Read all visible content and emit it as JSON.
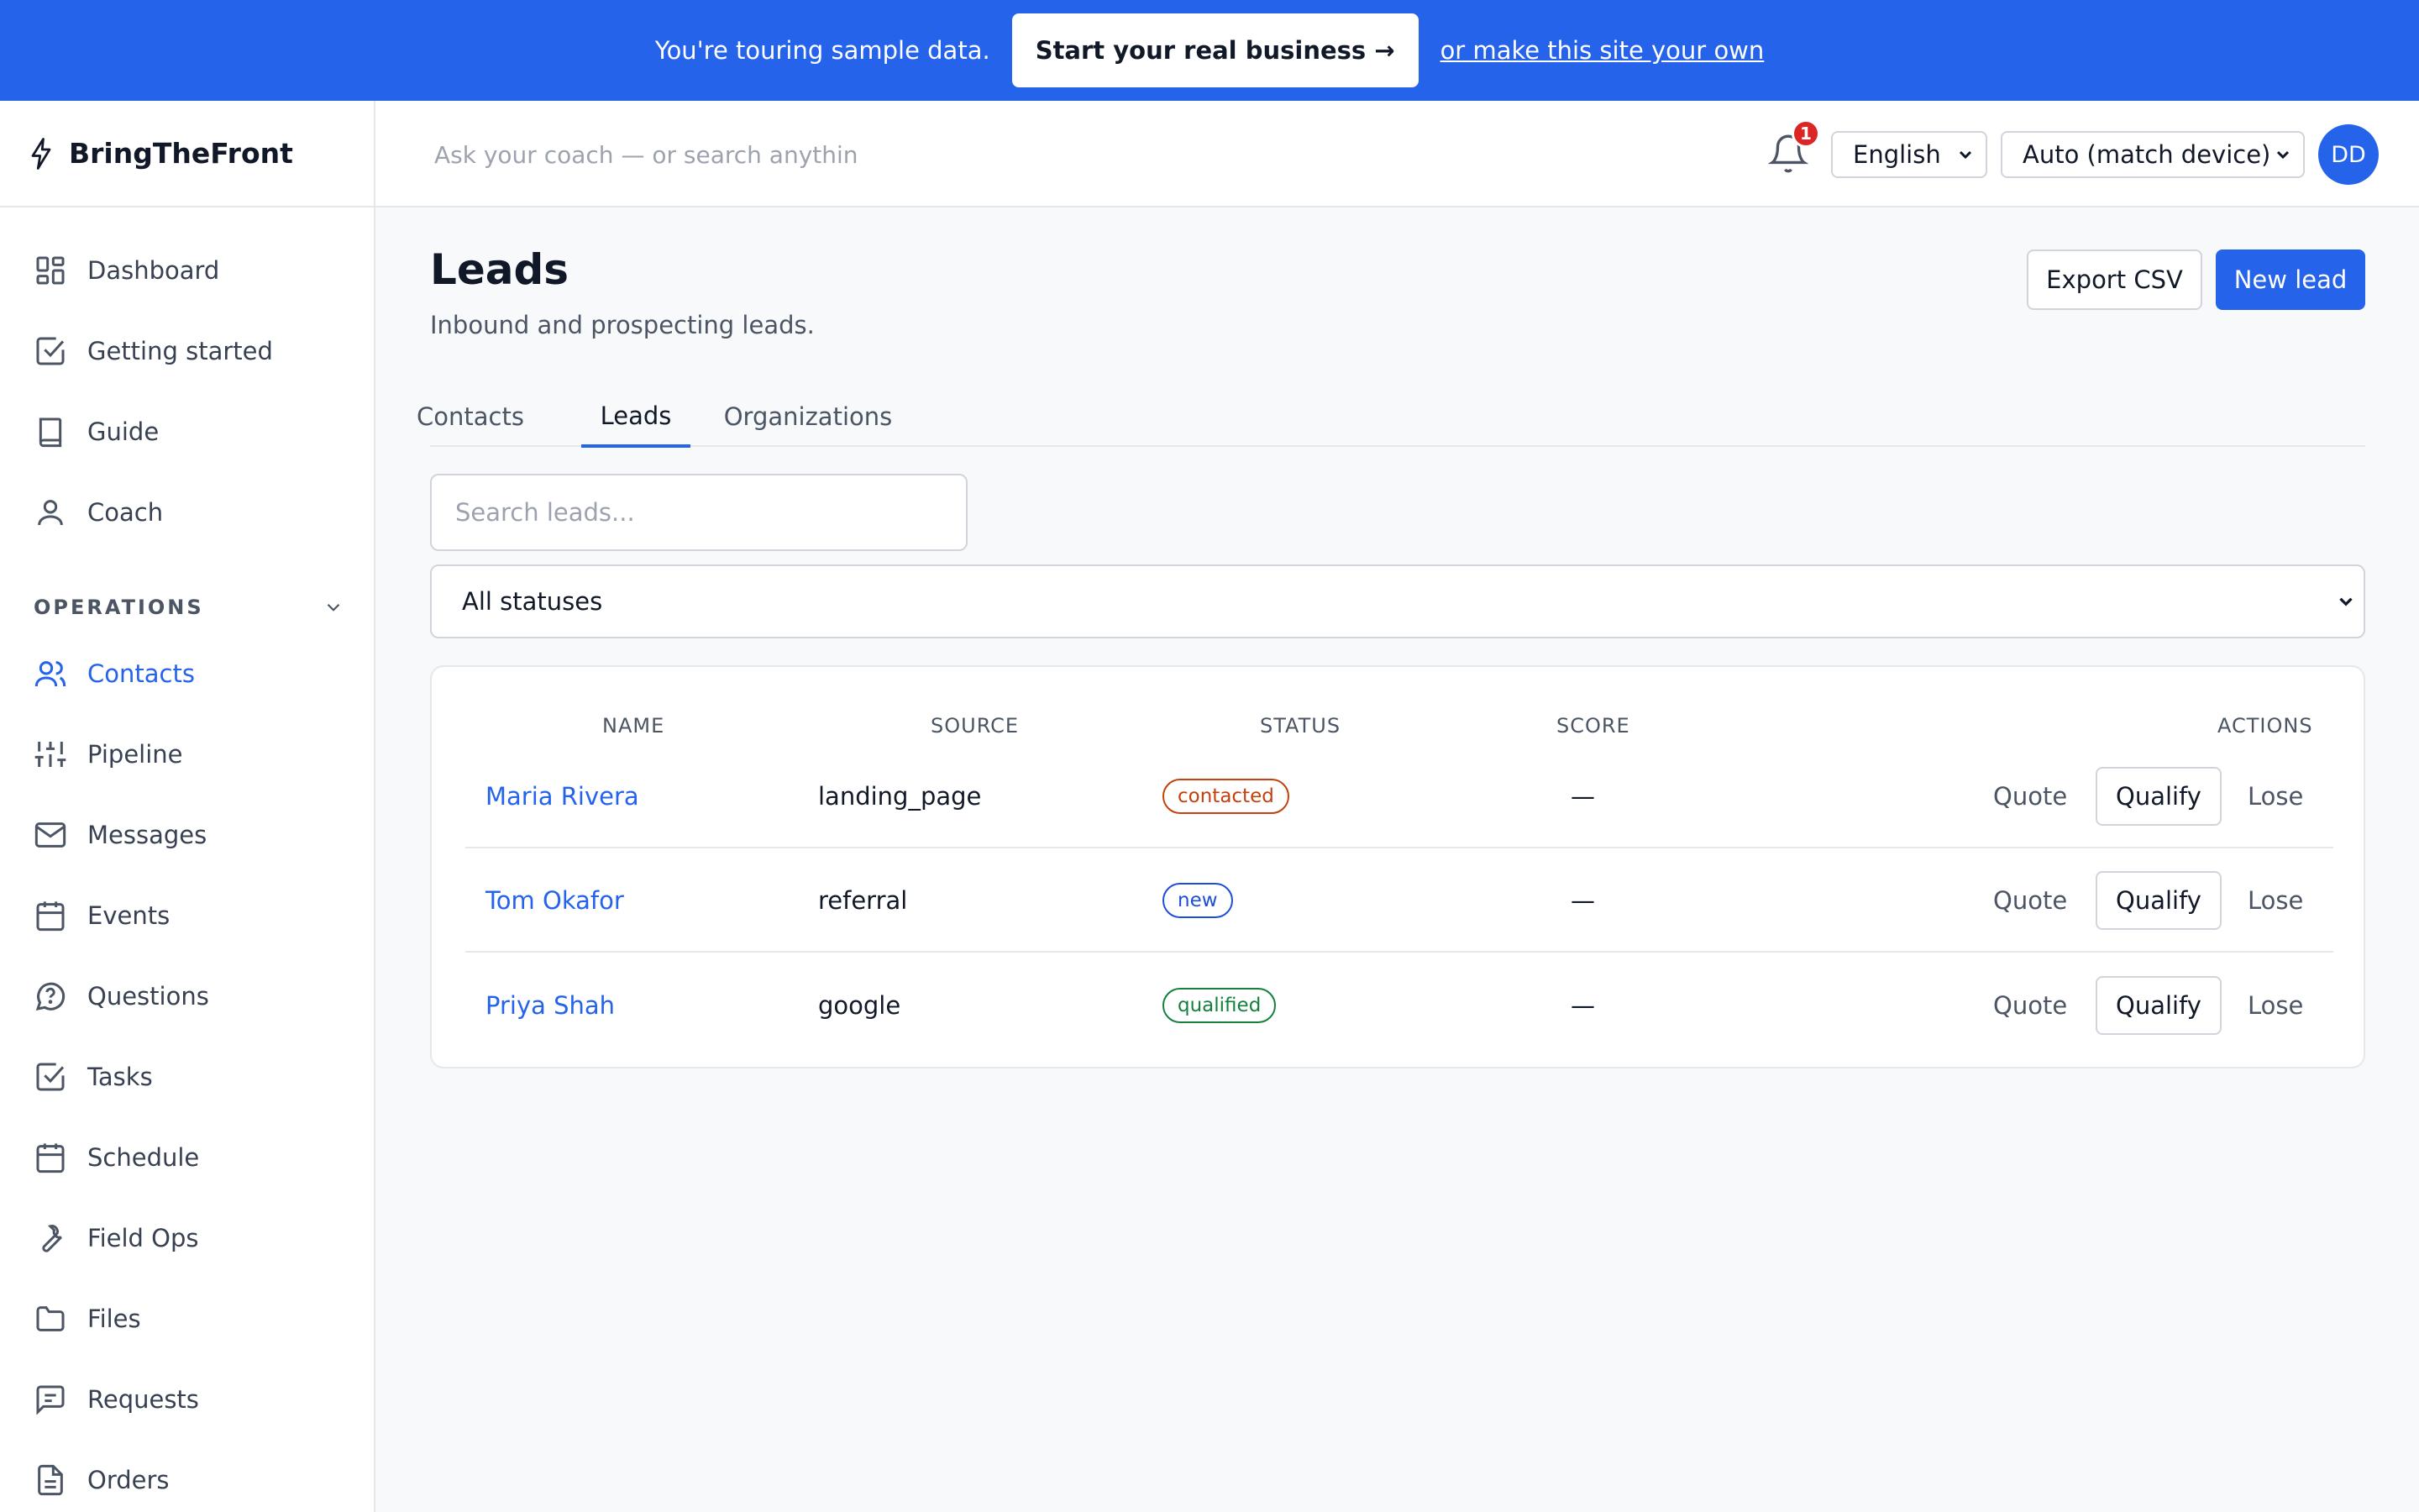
{
  "banner": {
    "text": "You're touring sample data.",
    "cta": "Start your real business →",
    "link": "or make this site your own"
  },
  "brand": {
    "name": "BringTheFront",
    "icon": "bolt-icon"
  },
  "sidebar": {
    "primary": [
      {
        "label": "Dashboard",
        "icon": "dashboard-icon"
      },
      {
        "label": "Getting started",
        "icon": "checkbox-icon"
      },
      {
        "label": "Guide",
        "icon": "book-icon"
      },
      {
        "label": "Coach",
        "icon": "user-icon"
      }
    ],
    "section_label": "OPERATIONS",
    "operations": [
      {
        "label": "Contacts",
        "icon": "users-icon",
        "active": true
      },
      {
        "label": "Pipeline",
        "icon": "sliders-icon"
      },
      {
        "label": "Messages",
        "icon": "mail-icon"
      },
      {
        "label": "Events",
        "icon": "calendar-icon"
      },
      {
        "label": "Questions",
        "icon": "question-bubble-icon"
      },
      {
        "label": "Tasks",
        "icon": "checkbox-icon"
      },
      {
        "label": "Schedule",
        "icon": "calendar-icon"
      },
      {
        "label": "Field Ops",
        "icon": "wrench-icon"
      },
      {
        "label": "Files",
        "icon": "folder-icon"
      },
      {
        "label": "Requests",
        "icon": "message-square-icon"
      },
      {
        "label": "Orders",
        "icon": "document-icon"
      }
    ]
  },
  "header": {
    "search_placeholder": "Ask your coach — or search anythin",
    "notifications_count": "1",
    "language": "English",
    "theme": "Auto (match device)",
    "avatar_initials": "DD"
  },
  "page": {
    "title": "Leads",
    "subtitle": "Inbound and prospecting leads.",
    "export_label": "Export CSV",
    "new_label": "New lead",
    "tabs": [
      {
        "label": "Contacts",
        "active": false
      },
      {
        "label": "Leads",
        "active": true
      },
      {
        "label": "Organizations",
        "active": false
      }
    ],
    "search_placeholder": "Search leads...",
    "status_filter": "All statuses"
  },
  "table": {
    "columns": [
      "NAME",
      "SOURCE",
      "STATUS",
      "SCORE",
      "ACTIONS"
    ],
    "rows": [
      {
        "name": "Maria Rivera",
        "source": "landing_page",
        "status": "contacted",
        "status_color": "#c2410c",
        "score": "—"
      },
      {
        "name": "Tom Okafor",
        "source": "referral",
        "status": "new",
        "status_color": "#1d4ed8",
        "score": "—"
      },
      {
        "name": "Priya Shah",
        "source": "google",
        "status": "qualified",
        "status_color": "#15803d",
        "score": "—"
      }
    ],
    "actions": {
      "quote": "Quote",
      "qualify": "Qualify",
      "lose": "Lose"
    }
  },
  "colors": {
    "accent": "#2563eb",
    "banner": "#2563eb",
    "badge": "#dc2626"
  }
}
